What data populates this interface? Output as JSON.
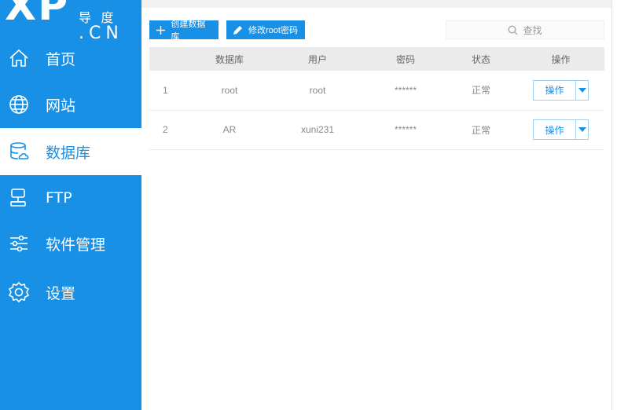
{
  "logo": {
    "main": "XP",
    "top": "导 度",
    "cn": ".CN"
  },
  "sidebar": {
    "items": [
      {
        "label": "首页",
        "icon": "home-icon"
      },
      {
        "label": "网站",
        "icon": "globe-icon"
      },
      {
        "label": "数据库",
        "icon": "database-icon",
        "active": true
      },
      {
        "label": "FTP",
        "icon": "ftp-icon"
      },
      {
        "label": "软件管理",
        "icon": "sliders-icon"
      },
      {
        "label": "设置",
        "icon": "gear-icon"
      }
    ]
  },
  "toolbar": {
    "create_label": "创建数据库",
    "modify_label": "修改root密码",
    "search_placeholder": "查找"
  },
  "table": {
    "headers": [
      "",
      "数据库",
      "用户",
      "密码",
      "状态",
      "操作"
    ],
    "rows": [
      {
        "num": "1",
        "db": "root",
        "user": "root",
        "password": "******",
        "status": "正常",
        "action": "操作"
      },
      {
        "num": "2",
        "db": "AR",
        "user": "xuni231",
        "password": "******",
        "status": "正常",
        "action": "操作"
      }
    ]
  },
  "colors": {
    "accent": "#1890e6",
    "background": "#f1f1f1",
    "header_bg": "#ebebeb"
  }
}
